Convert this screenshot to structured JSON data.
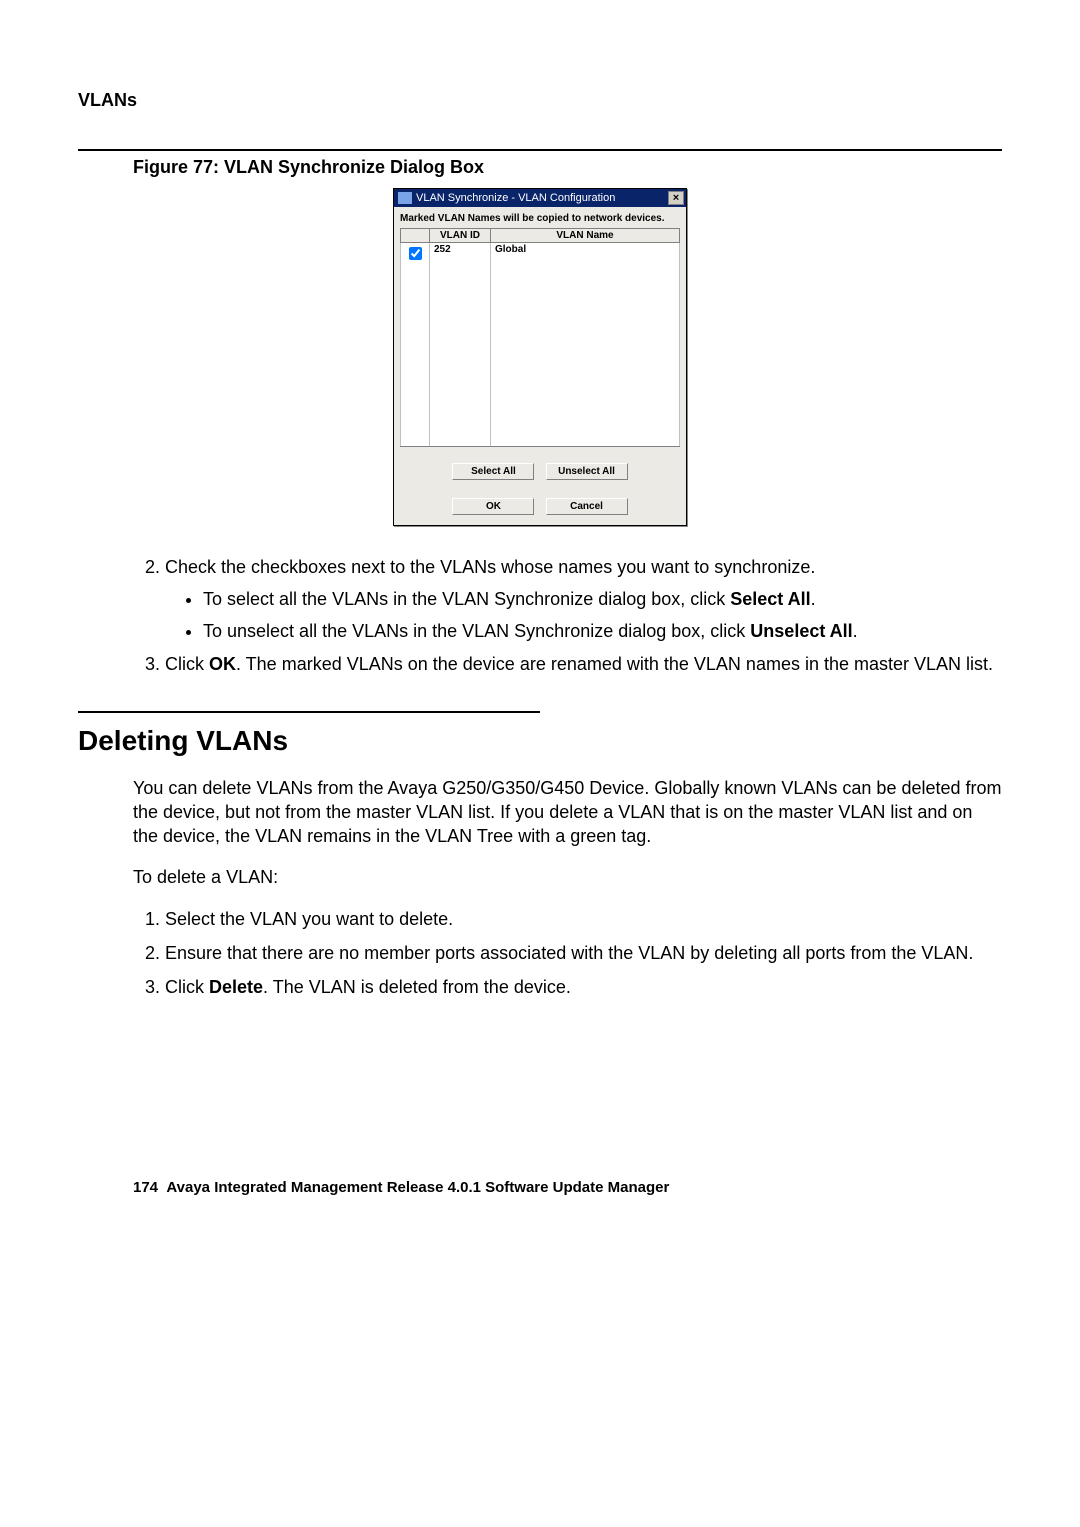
{
  "header": {
    "running": "VLANs"
  },
  "figure": {
    "caption": "Figure 77: VLAN Synchronize Dialog Box"
  },
  "dialog": {
    "title": "VLAN Synchronize - VLAN Configuration",
    "message": "Marked VLAN Names will be copied to network devices.",
    "columns": {
      "id": "VLAN ID",
      "name": "VLAN Name"
    },
    "rows": [
      {
        "checked": true,
        "id": "252",
        "name": "Global"
      }
    ],
    "buttons": {
      "selectAll": "Select All",
      "unselectAll": "Unselect All",
      "ok": "OK",
      "cancel": "Cancel"
    }
  },
  "content": {
    "step2_text": "Check the checkboxes next to the VLANs whose names you want to synchronize.",
    "bullet1_a": "To select all the VLANs in the VLAN Synchronize dialog box, click ",
    "bullet1_b": "Select All",
    "bullet1_c": ".",
    "bullet2_a": "To unselect all the VLANs in the VLAN Synchronize dialog box, click ",
    "bullet2_b": "Unselect All",
    "bullet2_c": ".",
    "step3_a": "Click ",
    "step3_b": "OK",
    "step3_c": ". The marked VLANs on the device are renamed with the VLAN names in the master VLAN list."
  },
  "section": {
    "title": "Deleting VLANs",
    "intro": "You can delete VLANs from the Avaya G250/G350/G450 Device. Globally known VLANs can be deleted from the device, but not from the master VLAN list. If you delete a VLAN that is on the master VLAN list and on the device, the VLAN remains in the VLAN Tree with a green tag.",
    "lead": "To delete a VLAN:",
    "s1": "Select the VLAN you want to delete.",
    "s2": "Ensure that there are no member ports associated with the VLAN by deleting all ports from the VLAN.",
    "s3_a": "Click ",
    "s3_b": "Delete",
    "s3_c": ". The VLAN is deleted from the device."
  },
  "footer": {
    "page": "174",
    "text": "Avaya Integrated Management Release 4.0.1 Software Update Manager"
  }
}
